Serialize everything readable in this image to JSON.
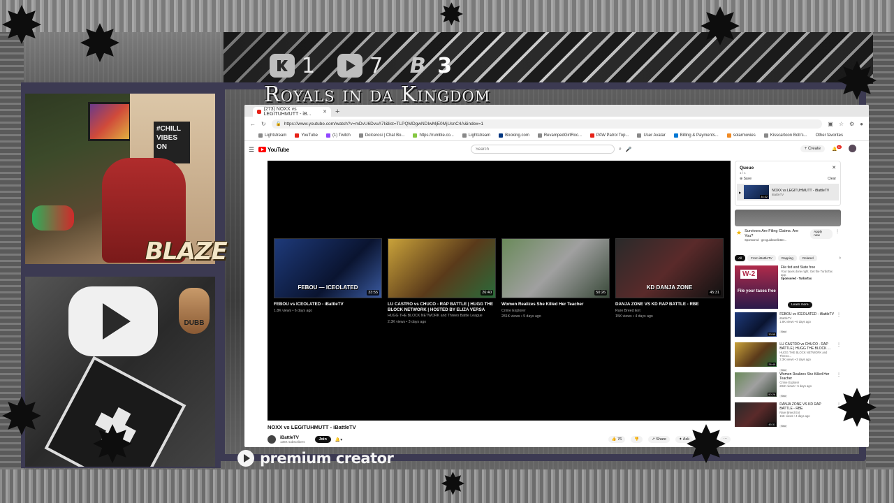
{
  "overlay": {
    "stats": [
      {
        "icon": "kick-icon",
        "value": "1"
      },
      {
        "icon": "rumble-icon",
        "value": "7"
      },
      {
        "icon": "b-icon",
        "value": "3"
      }
    ],
    "channel_title": "Royals in da Kingdom",
    "webcam_name": "BLAZE",
    "webcam_sign": "#CHILL VIBES ON",
    "hand_badge": "DUBB",
    "premium_creator": "premium creator"
  },
  "browser": {
    "tab_title": "(273) NOXX vs LEGITUHMUTT - iB...",
    "url": "https://www.youtube.com/watch?v=mDvU6DvuA7I&list=TLPQMDgwNDIwMjE0MjUsnC4A&index=1",
    "bookmarks": [
      "Lightstream",
      "YouTube",
      "(1) Twitch",
      "Dolcerosi | Chat Bo...",
      "https://rumble.co...",
      "Lightstream",
      "Booking.com",
      "RevampedGirlRoc...",
      "PAW Patrol Top...",
      "User Avatar",
      "Billing & Payments...",
      "solarmovies",
      "Kisscartoon Bob's..."
    ],
    "other_favorites": "Other favorites"
  },
  "youtube": {
    "logo_text": "YouTube",
    "search_placeholder": "Search",
    "create_label": "Create",
    "notification_count": "9+",
    "end_cards": [
      {
        "title": "FEBOU vs ICEOLATED - iBattleTV",
        "meta": "1.8K views • 6 days ago",
        "duration": "33:55",
        "thumb_label": "FEBOU — ICEOLATED"
      },
      {
        "title": "LU CASTRO vs CHUCO - RAP BATTLE | HUGG THE BLOCK NETWORK | HOSTED BY ELIZA VERSA",
        "meta": "HUGG THE BLOCK NETWORK and Threeo Battle League",
        "meta2": "2.3K views • 3 days ago",
        "duration": "26:40",
        "thumb_label": ""
      },
      {
        "title": "Women Realizes She Killed Her Teacher",
        "meta": "Crime Explorer",
        "meta2": "281K views • 5 days ago",
        "duration": "50:26",
        "thumb_label": ""
      },
      {
        "title": "DANJA ZONE VS KD RAP BATTLE - RBE",
        "meta": "Rare Breed Ent",
        "meta2": "15K views • 4 days ago",
        "duration": "45:31",
        "thumb_label": "KD DANJA ZONE"
      }
    ],
    "video_title": "NOXX vs LEGITUHMUTT - iBattleTV",
    "channel_name": "iBattleTV",
    "channel_subs": "136K subscribers",
    "join_label": "Join",
    "like_count": "76",
    "share_label": "Share",
    "ask_label": "Ask",
    "save_label": "Save",
    "queue": {
      "title": "Queue",
      "count": "1 / 1",
      "save": "Save",
      "clear": "Clear",
      "item_title": "NOXX vs LEGITUHMUTT - iBattleTV",
      "item_channel": "iBattleTV",
      "item_duration": "34:32"
    },
    "ad": {
      "title": "Survivors Are Filing Claims. Are You?",
      "sponsor": "Sponsored · get.guidewelletter...",
      "button": "Apply now"
    },
    "chips": [
      "All",
      "From iBattleTV",
      "Rapping",
      "Related"
    ],
    "side_ad": {
      "badge": "W-2",
      "overlay": "File your taxes free",
      "title": "File fed and State free",
      "desc": "Your taxes done right. Get the TurboTax app.",
      "sponsor": "Sponsored · TurboTax",
      "button": "Learn more"
    },
    "side_items": [
      {
        "title": "FEBOU vs ICEOLATED - iBattleTV",
        "channel": "iBattleTV",
        "meta": "1.8K views • 6 days ago",
        "badge": "New",
        "duration": "33:55"
      },
      {
        "title": "LU CASTRO vs CHUCO - RAP BATTLE | HUGG THE BLOCK ...",
        "channel": "HUGG THE BLOCK NETWORK and Threeo...",
        "meta": "2.3K views • 3 days ago",
        "badge": "New",
        "duration": "26:40"
      },
      {
        "title": "Women Realizes She Killed Her Teacher",
        "channel": "Crime Explorer",
        "meta": "281K views • 5 days ago",
        "badge": "New",
        "duration": "50:26"
      },
      {
        "title": "DANJA ZONE VS KD RAP BATTLE - RBE",
        "channel": "Rare Breed Ent",
        "meta": "15K views • 4 days ago",
        "badge": "New",
        "duration": "45:31"
      }
    ]
  }
}
